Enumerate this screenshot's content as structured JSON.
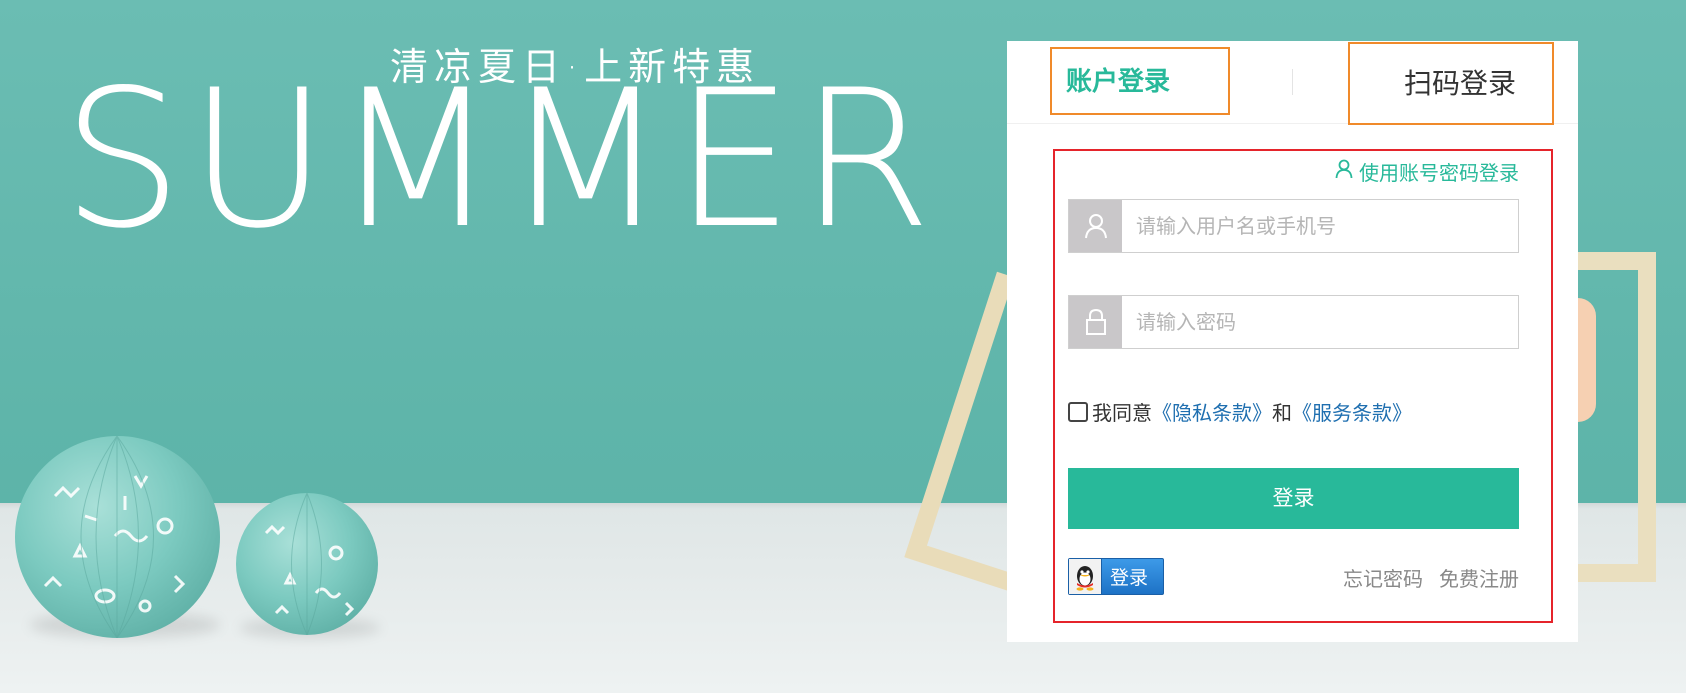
{
  "banner": {
    "subtitle": "清凉夏日·上新特惠",
    "title": "SUMMER"
  },
  "tabs": {
    "account_login": "账户登录",
    "qr_login": "扫码登录"
  },
  "form": {
    "switch_link": "使用账号密码登录",
    "username_placeholder": "请输入用户名或手机号",
    "password_placeholder": "请输入密码",
    "agree_prefix": "我同意",
    "privacy_link": "《隐私条款》",
    "agree_and": "和",
    "service_link": "《服务条款》",
    "login_button": "登录",
    "qq_login_label": "登录",
    "forgot_password": "忘记密码",
    "register": "免费注册"
  },
  "colors": {
    "accent": "#28b99a",
    "link": "#1f6fb0",
    "highlight_orange": "#f08a2a",
    "highlight_red": "#e5242b"
  },
  "icons": {
    "user": "user-icon",
    "lock": "lock-icon",
    "qq": "qq-penguin-icon",
    "switch": "user-outline-icon"
  }
}
